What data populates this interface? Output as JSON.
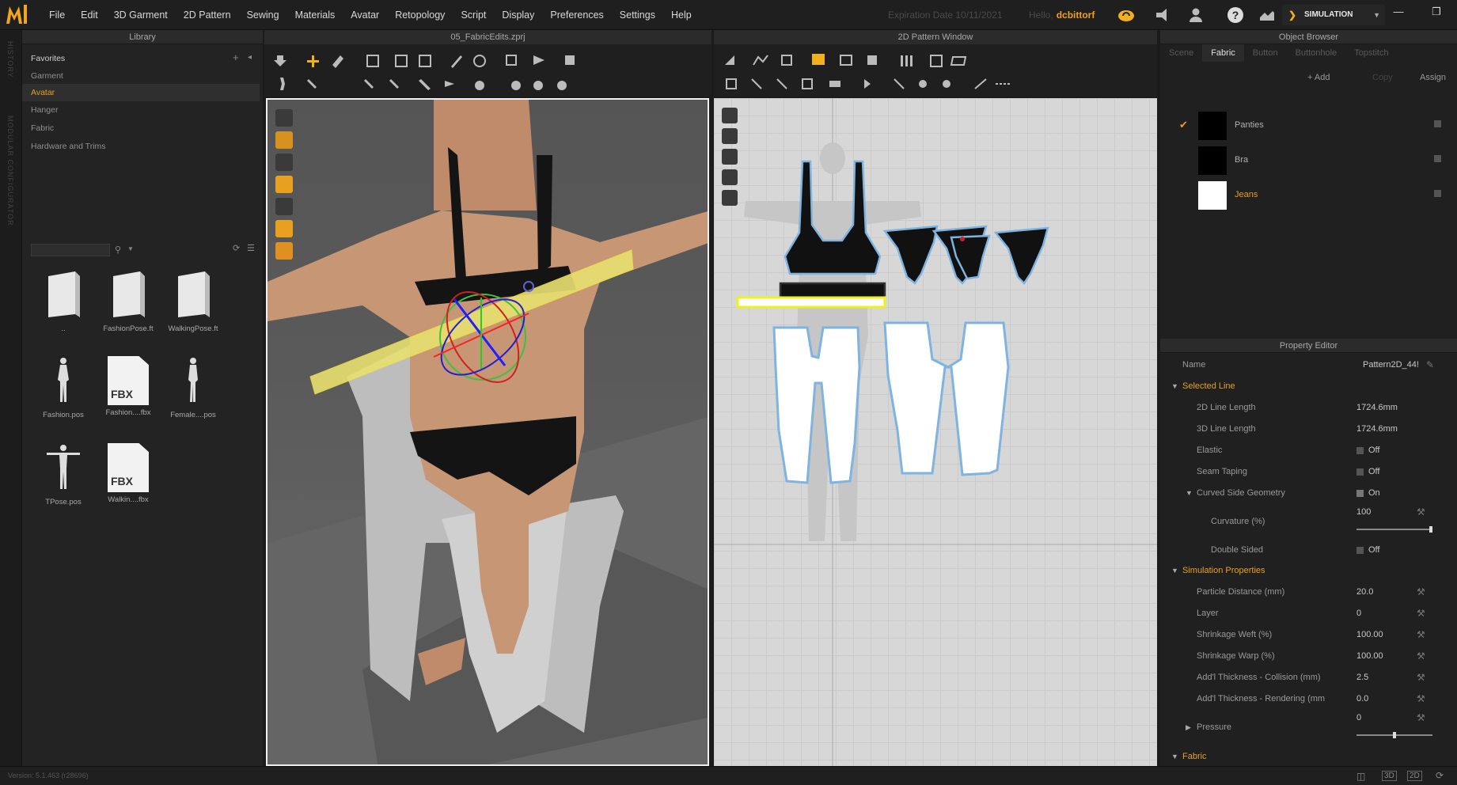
{
  "menubar": {
    "items": [
      "File",
      "Edit",
      "3D Garment",
      "2D Pattern",
      "Sewing",
      "Materials",
      "Avatar",
      "Retopology",
      "Script",
      "Display",
      "Preferences",
      "Settings",
      "Help"
    ],
    "expiration_label": "Expiration Date 10/11/2021",
    "hello_label": "Hello,",
    "username": "dcbittorf",
    "simulation_label": "SIMULATION"
  },
  "sidestrip": {
    "history": "HISTORY",
    "modular": "MODULAR CONFIGURATOR"
  },
  "library": {
    "title": "Library",
    "favorites_label": "Favorites",
    "items": [
      "Garment",
      "Avatar",
      "Hanger",
      "Fabric",
      "Hardware and Trims"
    ],
    "active_item": "Avatar",
    "thumbnails": [
      {
        "caption": "..",
        "kind": "folder"
      },
      {
        "caption": "FashionPose.ft",
        "kind": "folder"
      },
      {
        "caption": "WalkingPose.ft",
        "kind": "folder"
      },
      {
        "caption": "Fashion.pos",
        "kind": "pose"
      },
      {
        "caption": "Fashion....fbx",
        "kind": "fbx"
      },
      {
        "caption": "Female....pos",
        "kind": "pose"
      },
      {
        "caption": "TPose.pos",
        "kind": "tpose"
      },
      {
        "caption": "Walkin....fbx",
        "kind": "fbx"
      }
    ],
    "fbx_label": "FBX"
  },
  "view3d": {
    "title": "05_FabricEdits.zprj"
  },
  "view2d": {
    "title": "2D Pattern Window"
  },
  "object_browser": {
    "title": "Object Browser",
    "tabs": [
      "Scene",
      "Fabric",
      "Button",
      "Buttonhole",
      "Topstitch"
    ],
    "active_tab": "Fabric",
    "add_label": "+ Add",
    "copy_label": "Copy",
    "assign_label": "Assign",
    "fabrics": [
      {
        "name": "Panties",
        "color": "#000000",
        "checked": true
      },
      {
        "name": "Bra",
        "color": "#000000",
        "checked": false
      },
      {
        "name": "Jeans",
        "color": "#ffffff",
        "checked": false
      }
    ]
  },
  "property_editor": {
    "title": "Property Editor",
    "name_label": "Name",
    "name_value": "Pattern2D_44!",
    "selected_line": "Selected Line",
    "line_2d_label": "2D Line Length",
    "line_2d_value": "1724.6mm",
    "line_3d_label": "3D Line Length",
    "line_3d_value": "1724.6mm",
    "elastic_label": "Elastic",
    "elastic_value": "Off",
    "seam_taping_label": "Seam Taping",
    "seam_taping_value": "Off",
    "curved_label": "Curved Side Geometry",
    "curved_value": "On",
    "curvature_label": "Curvature (%)",
    "curvature_value": "100",
    "double_sided_label": "Double Sided",
    "double_sided_value": "Off",
    "sim_props": "Simulation Properties",
    "particle_label": "Particle Distance (mm)",
    "particle_value": "20.0",
    "layer_label": "Layer",
    "layer_value": "0",
    "weft_label": "Shrinkage Weft (%)",
    "weft_value": "100.00",
    "warp_label": "Shrinkage Warp (%)",
    "warp_value": "100.00",
    "thick_col_label": "Add'l Thickness - Collision (mm)",
    "thick_col_value": "2.5",
    "thick_ren_label": "Add'l Thickness - Rendering (mm",
    "thick_ren_value": "0.0",
    "pressure_label": "Pressure",
    "pressure_value": "0",
    "fabric_label": "Fabric",
    "curvature_fraction": 1.0,
    "pressure_fraction": 0.5
  },
  "status": {
    "version": "Version: 5.1.463 (r28696)"
  },
  "colors": {
    "accent": "#e8a020",
    "pattern_outline": "#7fb3e0"
  }
}
